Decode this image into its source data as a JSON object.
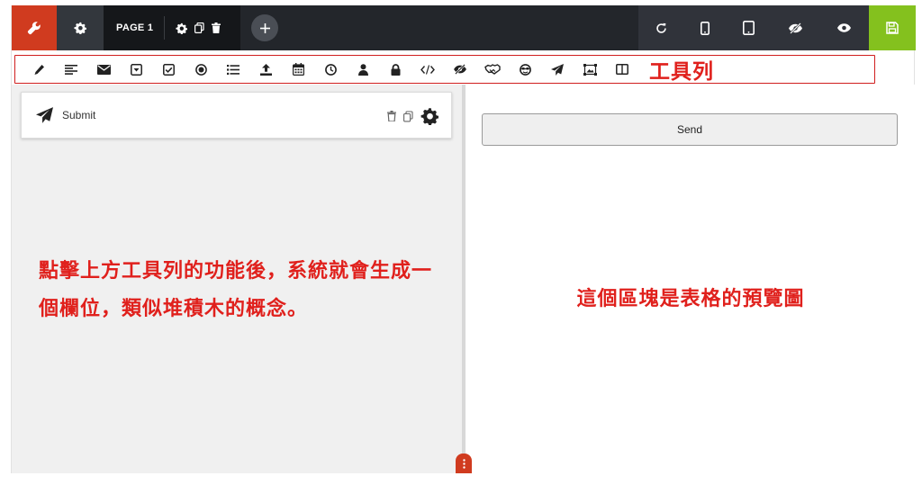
{
  "colors": {
    "accent_red": "#d03b1f",
    "save_green": "#84c11e",
    "annotation_red": "#e0201c",
    "topbar_dark": "#23262b"
  },
  "topbar": {
    "page_label": "PAGE 1",
    "icons": [
      "wrench-icon",
      "gear-icon",
      "gear-icon",
      "copy-icon",
      "trash-icon",
      "plus-icon",
      "refresh-icon",
      "mobile-icon",
      "tablet-icon",
      "eye-slash-icon",
      "eye-icon",
      "save-icon"
    ]
  },
  "toolbar": {
    "tools": [
      "pencil",
      "align-left",
      "envelope",
      "dropdown",
      "checkbox",
      "radio",
      "list",
      "upload",
      "calendar",
      "clock",
      "user",
      "lock",
      "code",
      "eye-slash",
      "handshake",
      "smiley",
      "paper-plane",
      "image",
      "columns"
    ],
    "note": "工具列"
  },
  "builder": {
    "field_label": "Submit",
    "note": "點擊上方工具列的功能後，系統就會生成一個欄位，類似堆積木的概念。"
  },
  "preview": {
    "send_label": "Send",
    "note": "這個區塊是表格的預覽圖"
  }
}
